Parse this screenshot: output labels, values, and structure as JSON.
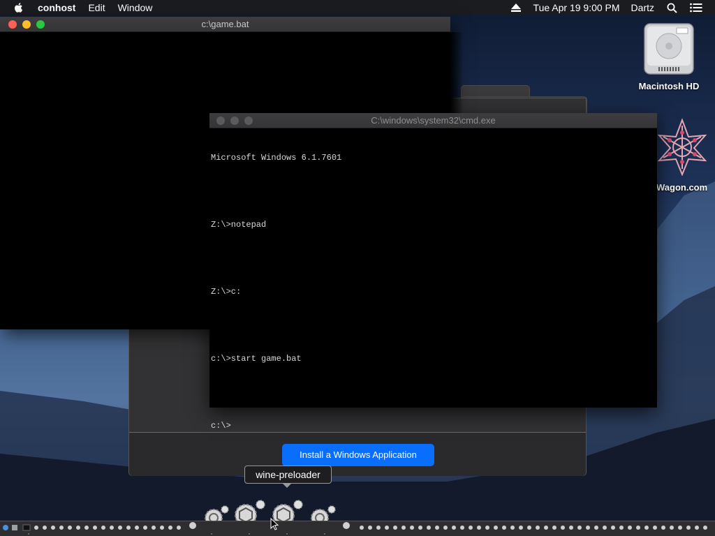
{
  "menubar": {
    "app_name": "conhost",
    "items": [
      "Edit",
      "Window"
    ],
    "clock": "Tue Apr 19  9:00 PM",
    "user": "Dartz",
    "icons": [
      "apple-icon",
      "eject-icon",
      "spotlight-search-icon",
      "notification-center-icon"
    ]
  },
  "desktop": {
    "hd_label": "Macintosh HD",
    "wagon_label": "Wagon.com"
  },
  "game_window": {
    "title": "c:\\game.bat"
  },
  "cmd_window": {
    "title": "C:\\windows\\system32\\cmd.exe",
    "lines": [
      "Microsoft Windows 6.1.7601",
      "",
      "Z:\\>notepad",
      "",
      "Z:\\>c:",
      "",
      "c:\\>start game.bat",
      "",
      "c:\\>"
    ]
  },
  "wine_window": {
    "install_button": "Install a Windows Application"
  },
  "dock": {
    "tooltip": "wine-preloader",
    "app_icon": "wine-preloader-gear-icon"
  },
  "colors": {
    "accent": "#0a6efc",
    "close": "#fe5f57",
    "minimize": "#febc2e",
    "maximize": "#28c840"
  }
}
